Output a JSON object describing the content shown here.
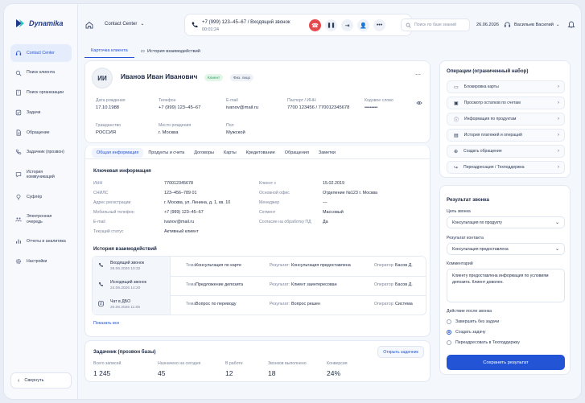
{
  "app": {
    "name": "Dynamika"
  },
  "sidebar": {
    "items": [
      {
        "label": "Contact Center",
        "icon": "headset-icon"
      },
      {
        "label": "Поиск клиента",
        "icon": "search-icon"
      },
      {
        "label": "Поиск организации",
        "icon": "building-icon"
      },
      {
        "label": "Задачи",
        "icon": "checkbox-icon"
      },
      {
        "label": "Обращение",
        "icon": "document-icon"
      },
      {
        "label": "Задачник (прозвон)",
        "icon": "phone-icon"
      },
      {
        "label": "История коммуникаций",
        "icon": "chat-icon"
      },
      {
        "label": "Суфлёр",
        "icon": "lightbulb-icon"
      },
      {
        "label": "Электронная очередь",
        "icon": "queue-icon"
      },
      {
        "label": "Отчеты и аналитика",
        "icon": "chart-icon"
      },
      {
        "label": "Настройки",
        "icon": "gear-icon"
      }
    ],
    "collapse_label": "Свернуть"
  },
  "topbar": {
    "center_select": "Contact Center",
    "call_title": "+7 (999) 123–45–67 / Входящий звонок",
    "call_time": "00:01:24",
    "search_placeholder": "Поиск по базе знаний",
    "date": "26.06.2026",
    "user_name": "Васильев Василий"
  },
  "tabs": {
    "client_card": "Карточка клиента",
    "history": "История взаимодействий"
  },
  "client": {
    "initials": "ИИ",
    "name": "Иванов Иван Иванович",
    "badge_client": "Клиент",
    "badge_type": "Физ. лицо",
    "fields": [
      {
        "label": "Дата рождения",
        "value": "17.10.1988"
      },
      {
        "label": "Телефон",
        "value": "+7 (999) 123–45–67"
      },
      {
        "label": "E-mail",
        "value": "ivanov@mail.ru"
      },
      {
        "label": "Паспорт / ИНН",
        "value": "7700 123456 / 770012345678"
      },
      {
        "label": "Кодовое слово",
        "value": "••••••••"
      },
      {
        "label": "Гражданство",
        "value": "РОССИЯ"
      },
      {
        "label": "Место рождения",
        "value": "г. Москва"
      },
      {
        "label": "Пол",
        "value": "Мужской"
      }
    ]
  },
  "subtabs": [
    "Общая информация",
    "Продукты и счета",
    "Договоры",
    "Карты",
    "Кредитование",
    "Обращения",
    "Заметки"
  ],
  "key_info": {
    "title": "Ключевая информация",
    "left": [
      {
        "label": "ИНН",
        "value": "770012345678"
      },
      {
        "label": "СНИЛС",
        "value": "123–456–789 01"
      },
      {
        "label": "Адрес регистрации",
        "value": "г. Москва, ул. Ленина, д. 1, кв. 10"
      },
      {
        "label": "Мобильный телефон",
        "value": "+7 (999) 123–45–67"
      },
      {
        "label": "E-mail",
        "value": "ivanov@mail.ru"
      },
      {
        "label": "Текущий статус",
        "value": "Активный клиент"
      }
    ],
    "right": [
      {
        "label": "Клиент с",
        "value": "15.02.2019"
      },
      {
        "label": "Основной офис",
        "value": "Отделение №123 г. Москва"
      },
      {
        "label": "Менеджер",
        "value": "—"
      },
      {
        "label": "Сегмент",
        "value": "Массовый"
      },
      {
        "label": "Согласие на обработку ПД",
        "value": "Да"
      }
    ]
  },
  "history": {
    "title": "История взаимодействий",
    "rows": [
      {
        "type": "Входящий звонок",
        "date": "26.06.2026 10:32",
        "topic_label": "Тема:",
        "topic": "Консультация по карте",
        "result_label": "Результат:",
        "result": "Консультация предоставлена",
        "op_label": "Оператор:",
        "operator": "Басов Д."
      },
      {
        "type": "Исходящий звонок",
        "date": "24.06.2026 14:20",
        "topic_label": "Тема:",
        "topic": "Предложение депозита",
        "result_label": "Результат:",
        "result": "Клиент заинтересован",
        "op_label": "Оператор:",
        "operator": "Басов Д."
      },
      {
        "type": "Чат в ДБО",
        "date": "20.06.2026 11:05",
        "topic_label": "Тема:",
        "topic": "Вопрос по переводу",
        "result_label": "Результат:",
        "result": "Вопрос решен",
        "op_label": "Оператор:",
        "operator": "Система"
      }
    ],
    "show_all": "Показать все"
  },
  "tasks": {
    "title": "Задачник (прозвон базы)",
    "open_button": "Открыть задачник",
    "stats": [
      {
        "label": "Всего записей",
        "value": "1 245"
      },
      {
        "label": "Назначено на сегодня",
        "value": "45"
      },
      {
        "label": "В работе",
        "value": "12"
      },
      {
        "label": "Звонков выполнено",
        "value": "18"
      },
      {
        "label": "Конверсия",
        "value": "24%"
      }
    ]
  },
  "operations": {
    "title": "Операции (ограниченный набор)",
    "items": [
      {
        "label": "Блокировка карты",
        "icon": "card-icon"
      },
      {
        "label": "Просмотр остатков по счетам",
        "icon": "wallet-icon"
      },
      {
        "label": "Информация по продуктам",
        "icon": "info-icon"
      },
      {
        "label": "История платежей и операций",
        "icon": "history-icon"
      },
      {
        "label": "Создать обращение",
        "icon": "plus-icon"
      },
      {
        "label": "Переадресация / Техподдержка",
        "icon": "forward-icon"
      }
    ]
  },
  "call_result": {
    "title": "Результат звонка",
    "goal_label": "Цель звонка",
    "goal_value": "Консультация по продукту",
    "contact_label": "Результат контакта",
    "contact_value": "Консультация предоставлена",
    "comment_label": "Комментарий",
    "comment_value": "Клиенту предоставлена информация по условиям депозита. Клиент доволен.",
    "action_label": "Действие после звонка",
    "options": [
      "Завершить без задачи",
      "Создать задачу",
      "Переадресовать в Техподдержку"
    ],
    "selected_option": "Создать задачу",
    "save_button": "Сохранить результат"
  },
  "colors": {
    "accent": "#2454d6",
    "danger": "#e5484d",
    "success": "#2e9e5b"
  }
}
